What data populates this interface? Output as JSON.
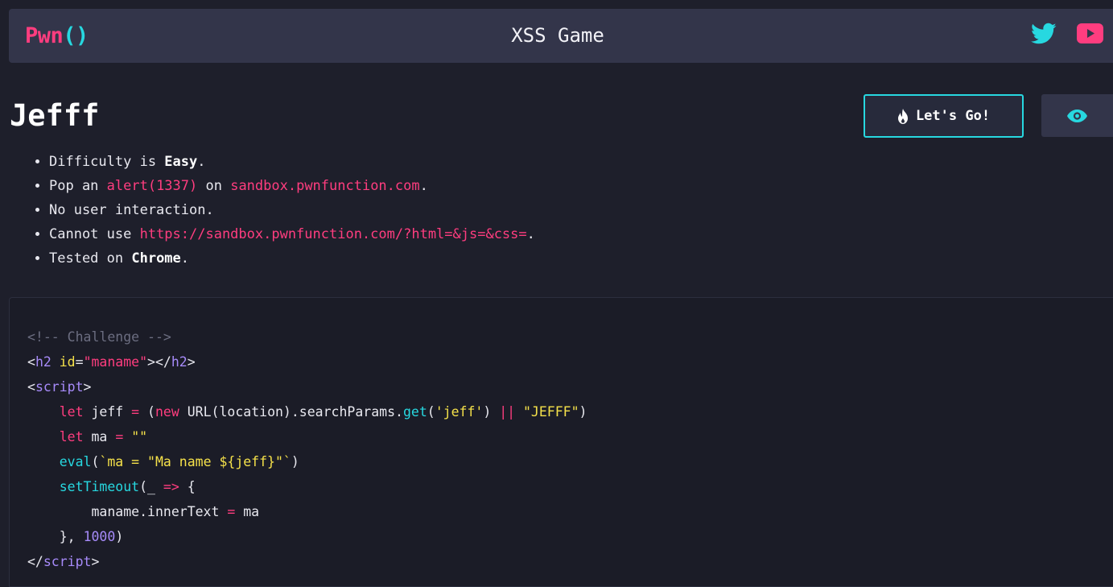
{
  "nav": {
    "logo_pwn": "Pwn",
    "logo_paren": "()",
    "title": "XSS Game",
    "icons": [
      "twitter-icon",
      "youtube-icon"
    ]
  },
  "challenge": {
    "title": "Jefff",
    "go_button_label": "Let's Go!",
    "go_icon": "fire-icon",
    "view_icon": "eye-icon"
  },
  "rules": [
    {
      "pre": "Difficulty is ",
      "bold": "Easy",
      "post": "."
    },
    {
      "pre": "Pop an ",
      "hl1": "alert(1337)",
      "mid": " on ",
      "hl2": "sandbox.pwnfunction.com",
      "post": "."
    },
    {
      "text": "No user interaction."
    },
    {
      "pre": "Cannot use ",
      "hl": "https://sandbox.pwnfunction.com/?html=&js=&css=",
      "post": "."
    },
    {
      "pre": "Tested on ",
      "bold": "Chrome",
      "post": "."
    }
  ],
  "code": {
    "comment": "<!-- Challenge -->",
    "h2_tag": "h2",
    "h2_attr": "id",
    "h2_val": "\"maname\"",
    "script_tag": "script",
    "let": "let",
    "jeff_var": " jeff ",
    "new": "new",
    "url_expr": " URL(location).searchParams.",
    "get": "get",
    "jeff_str": "'jeff'",
    "or": "||",
    "default_str": "\"JEFFF\"",
    "ma_var": " ma ",
    "empty_str": "\"\"",
    "eval": "eval",
    "eval_str": "`ma = \"Ma name ${jeff}\"`",
    "settimeout": "setTimeout",
    "arrow_param": "_ ",
    "arrow": "=>",
    "inner_line": "maname.innerText ",
    "ma_end": " ma",
    "close_args": "}, ",
    "delay": "1000",
    "colors": {
      "accent_pink": "#ff3d7f",
      "accent_cyan": "#27d8e0",
      "accent_yellow": "#f5e14a",
      "accent_purple": "#a78bfa"
    }
  }
}
